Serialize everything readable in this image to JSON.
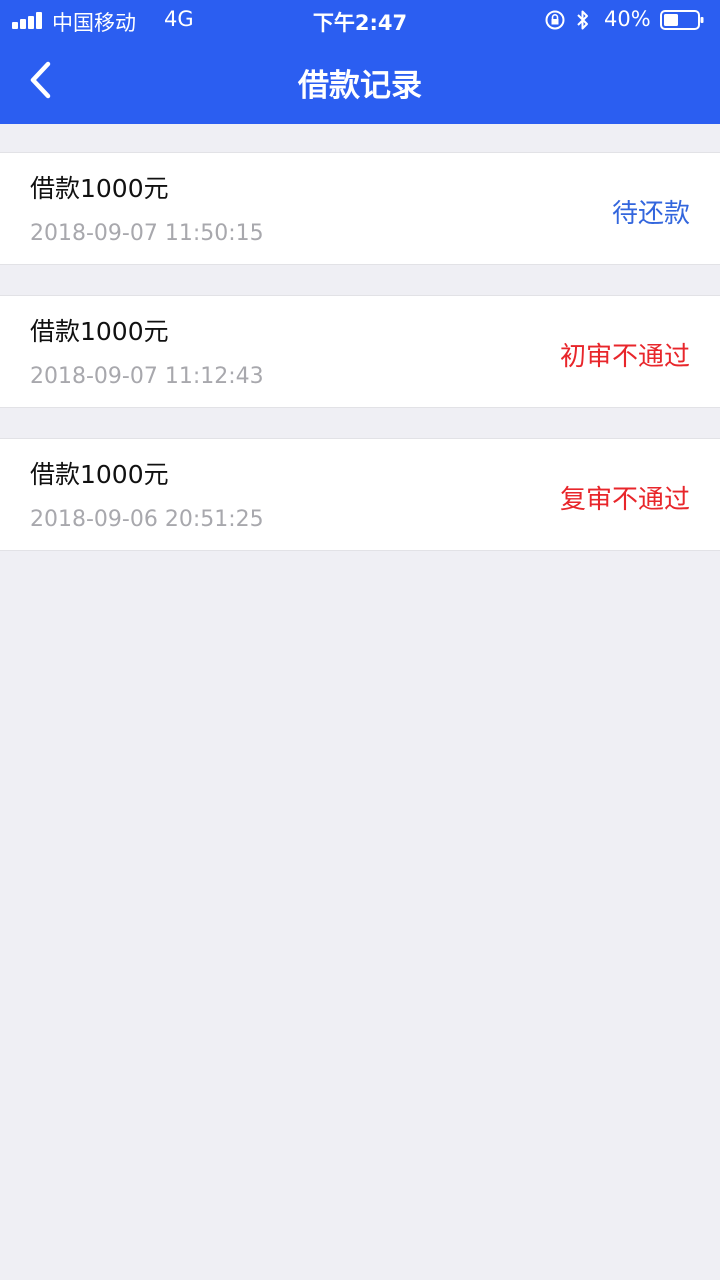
{
  "status_bar": {
    "carrier": "中国移动",
    "network": "4G",
    "time": "下午2:47",
    "battery": "40%"
  },
  "nav": {
    "title": "借款记录"
  },
  "colors": {
    "header_bg": "#2b5ef1",
    "page_bg": "#efeff4",
    "status_pending": "#3366dd",
    "status_rejected": "#e8262b"
  },
  "records": [
    {
      "amount": "借款1000元",
      "time": "2018-09-07 11:50:15",
      "status": "待还款",
      "status_color": "#3366dd"
    },
    {
      "amount": "借款1000元",
      "time": "2018-09-07 11:12:43",
      "status": "初审不通过",
      "status_color": "#e8262b"
    },
    {
      "amount": "借款1000元",
      "time": "2018-09-06 20:51:25",
      "status": "复审不通过",
      "status_color": "#e8262b"
    }
  ]
}
